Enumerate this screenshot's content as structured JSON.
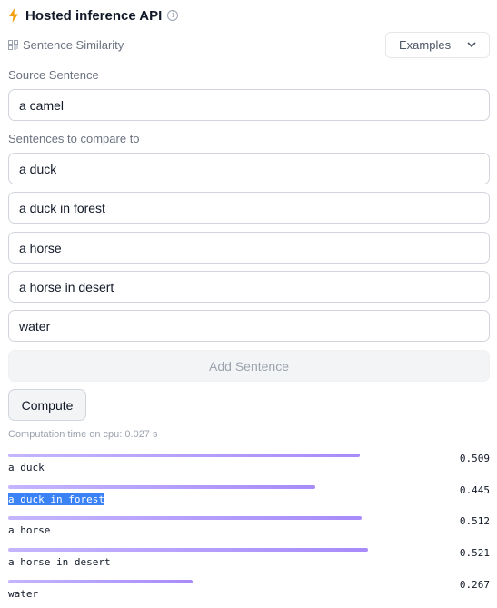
{
  "header": {
    "title": "Hosted inference API",
    "info_symbol": "i"
  },
  "task": {
    "label": "Sentence Similarity"
  },
  "examples_dropdown": {
    "label": "Examples"
  },
  "source": {
    "label": "Source Sentence",
    "value": "a camel"
  },
  "compare": {
    "label": "Sentences to compare to",
    "sentences": [
      "a duck",
      "a duck in forest",
      "a horse",
      "a horse in desert",
      "water"
    ]
  },
  "add_sentence_label": "Add Sentence",
  "compute_label": "Compute",
  "computation_time": "Computation time on cpu: 0.027 s",
  "results": [
    {
      "label": "a duck",
      "score": "0.509",
      "value": 0.509,
      "selected": false
    },
    {
      "label": "a duck in forest",
      "score": "0.445",
      "value": 0.445,
      "selected": true
    },
    {
      "label": "a horse",
      "score": "0.512",
      "value": 0.512,
      "selected": false
    },
    {
      "label": "a horse in desert",
      "score": "0.521",
      "value": 0.521,
      "selected": false
    },
    {
      "label": "water",
      "score": "0.267",
      "value": 0.267,
      "selected": false
    }
  ],
  "colors": {
    "bolt": "#f59e0b",
    "bar_start": "#c4b5fd",
    "bar_end": "#a78bfa",
    "selection": "#3b82f6"
  }
}
